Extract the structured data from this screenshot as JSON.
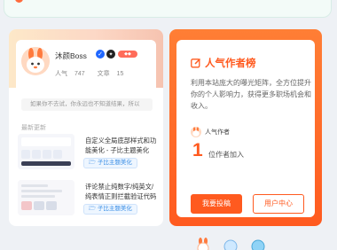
{
  "profile": {
    "name": "沐颜Boss",
    "stats": [
      {
        "label": "人气",
        "value": "747"
      },
      {
        "label": "文章",
        "value": "15"
      }
    ],
    "motto": "如果你不去试，你永远也不知道结果，所以"
  },
  "recent": {
    "title": "最新更新",
    "posts": [
      {
        "title": "自定义全局底部样式和功能美化 - 子比主题美化",
        "category": "子比主题美化"
      },
      {
        "title": "评论禁止纯数字/纯英文/纯表情正则拦截验证代码",
        "category": "子比主题美化"
      }
    ]
  },
  "popular": {
    "title": "人气作者榜",
    "description": "利用本站庞大的曝光矩阵，全方位提升你的个人影响力，获得更多职场机会和收入。",
    "author_label": "人气作者",
    "count": "1",
    "count_label": "位作者加入",
    "primary_button": "我要投稿",
    "secondary_button": "用户中心"
  },
  "colors": {
    "accent": "#ff5a1f",
    "link": "#3a8ee6",
    "verify": "#1f67ff"
  },
  "icons": {
    "edit": "edit-icon",
    "folder": "folder-icon",
    "verify": "verified-icon"
  }
}
